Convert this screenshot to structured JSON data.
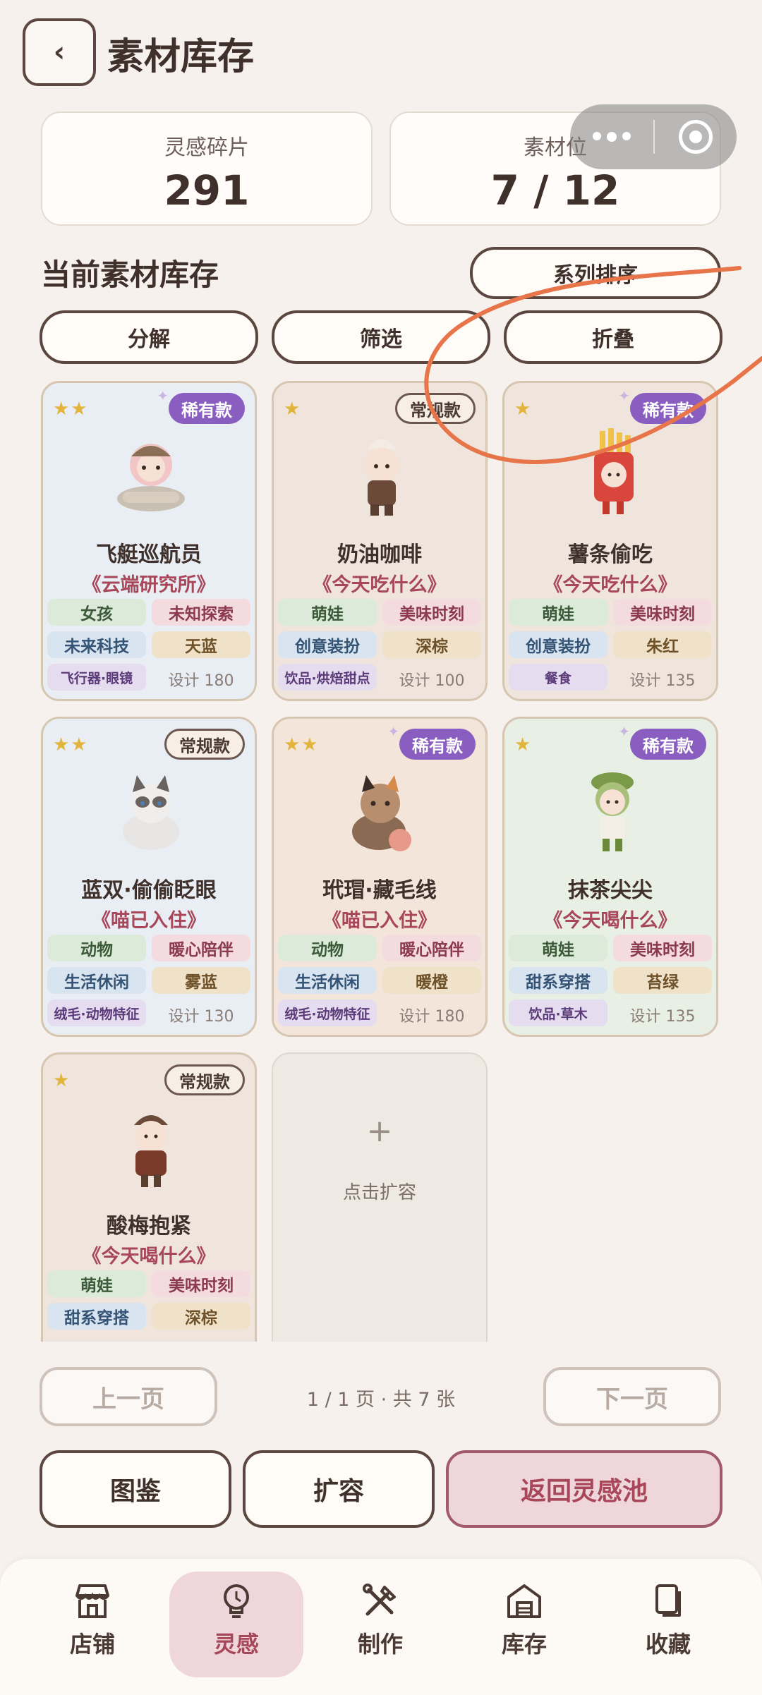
{
  "header": {
    "back_label": "‹",
    "title": "素材库存"
  },
  "stats": [
    {
      "label": "灵感碎片",
      "value": "291"
    },
    {
      "label": "素材位",
      "value": "7 / 12"
    }
  ],
  "section": {
    "title": "当前素材库存",
    "sort_label": "系列排序"
  },
  "toolbar": {
    "decompose": "分解",
    "filter": "筛选",
    "collapse": "折叠"
  },
  "cards": [
    {
      "stars": "★★",
      "badge": "稀有款",
      "name": "飞艇巡航员",
      "series": "《云端研究所》",
      "tags": [
        "女孩",
        "未知探索",
        "未来科技",
        "天蓝"
      ],
      "feature": "飞行器·眼镜",
      "design": "设计 180"
    },
    {
      "stars": "★",
      "badge": "常规款",
      "name": "奶油咖啡",
      "series": "《今天吃什么》",
      "tags": [
        "萌娃",
        "美味时刻",
        "创意装扮",
        "深棕"
      ],
      "feature": "饮品·烘焙甜点",
      "design": "设计 100"
    },
    {
      "stars": "★",
      "badge": "稀有款",
      "name": "薯条偷吃",
      "series": "《今天吃什么》",
      "tags": [
        "萌娃",
        "美味时刻",
        "创意装扮",
        "朱红"
      ],
      "feature": "餐食",
      "design": "设计 135"
    },
    {
      "stars": "★★",
      "badge": "常规款",
      "name": "蓝双·偷偷眨眼",
      "series": "《喵已入住》",
      "tags": [
        "动物",
        "暖心陪伴",
        "生活休闲",
        "雾蓝"
      ],
      "feature": "绒毛·动物特征",
      "design": "设计 130"
    },
    {
      "stars": "★★",
      "badge": "稀有款",
      "name": "玳瑁·藏毛线",
      "series": "《喵已入住》",
      "tags": [
        "动物",
        "暖心陪伴",
        "生活休闲",
        "暖橙"
      ],
      "feature": "绒毛·动物特征",
      "design": "设计 180"
    },
    {
      "stars": "★",
      "badge": "稀有款",
      "name": "抹茶尖尖",
      "series": "《今天喝什么》",
      "tags": [
        "萌娃",
        "美味时刻",
        "甜系穿搭",
        "苔绿"
      ],
      "feature": "饮品·草木",
      "design": "设计 135"
    },
    {
      "stars": "★",
      "badge": "常规款",
      "name": "酸梅抱紧",
      "series": "《今天喝什么》",
      "tags": [
        "萌娃",
        "美味时刻",
        "甜系穿搭",
        "深棕"
      ],
      "feature": "",
      "design": ""
    }
  ],
  "expand_slot": {
    "plus": "+",
    "label": "点击扩容"
  },
  "pager": {
    "prev": "上一页",
    "info": "1 / 1 页 · 共 7 张",
    "next": "下一页"
  },
  "actions": {
    "catalog": "图鉴",
    "expand": "扩容",
    "back_pool": "返回灵感池"
  },
  "tabs": [
    {
      "label": "店铺",
      "icon": "shop-icon"
    },
    {
      "label": "灵感",
      "icon": "bulb-icon",
      "active": true
    },
    {
      "label": "制作",
      "icon": "tools-icon"
    },
    {
      "label": "库存",
      "icon": "warehouse-icon"
    },
    {
      "label": "收藏",
      "icon": "collection-icon"
    }
  ],
  "colors": {
    "accent": "#a8475a",
    "rare_badge": "#8a5ec0",
    "annotation_stroke": "#e8744a"
  }
}
